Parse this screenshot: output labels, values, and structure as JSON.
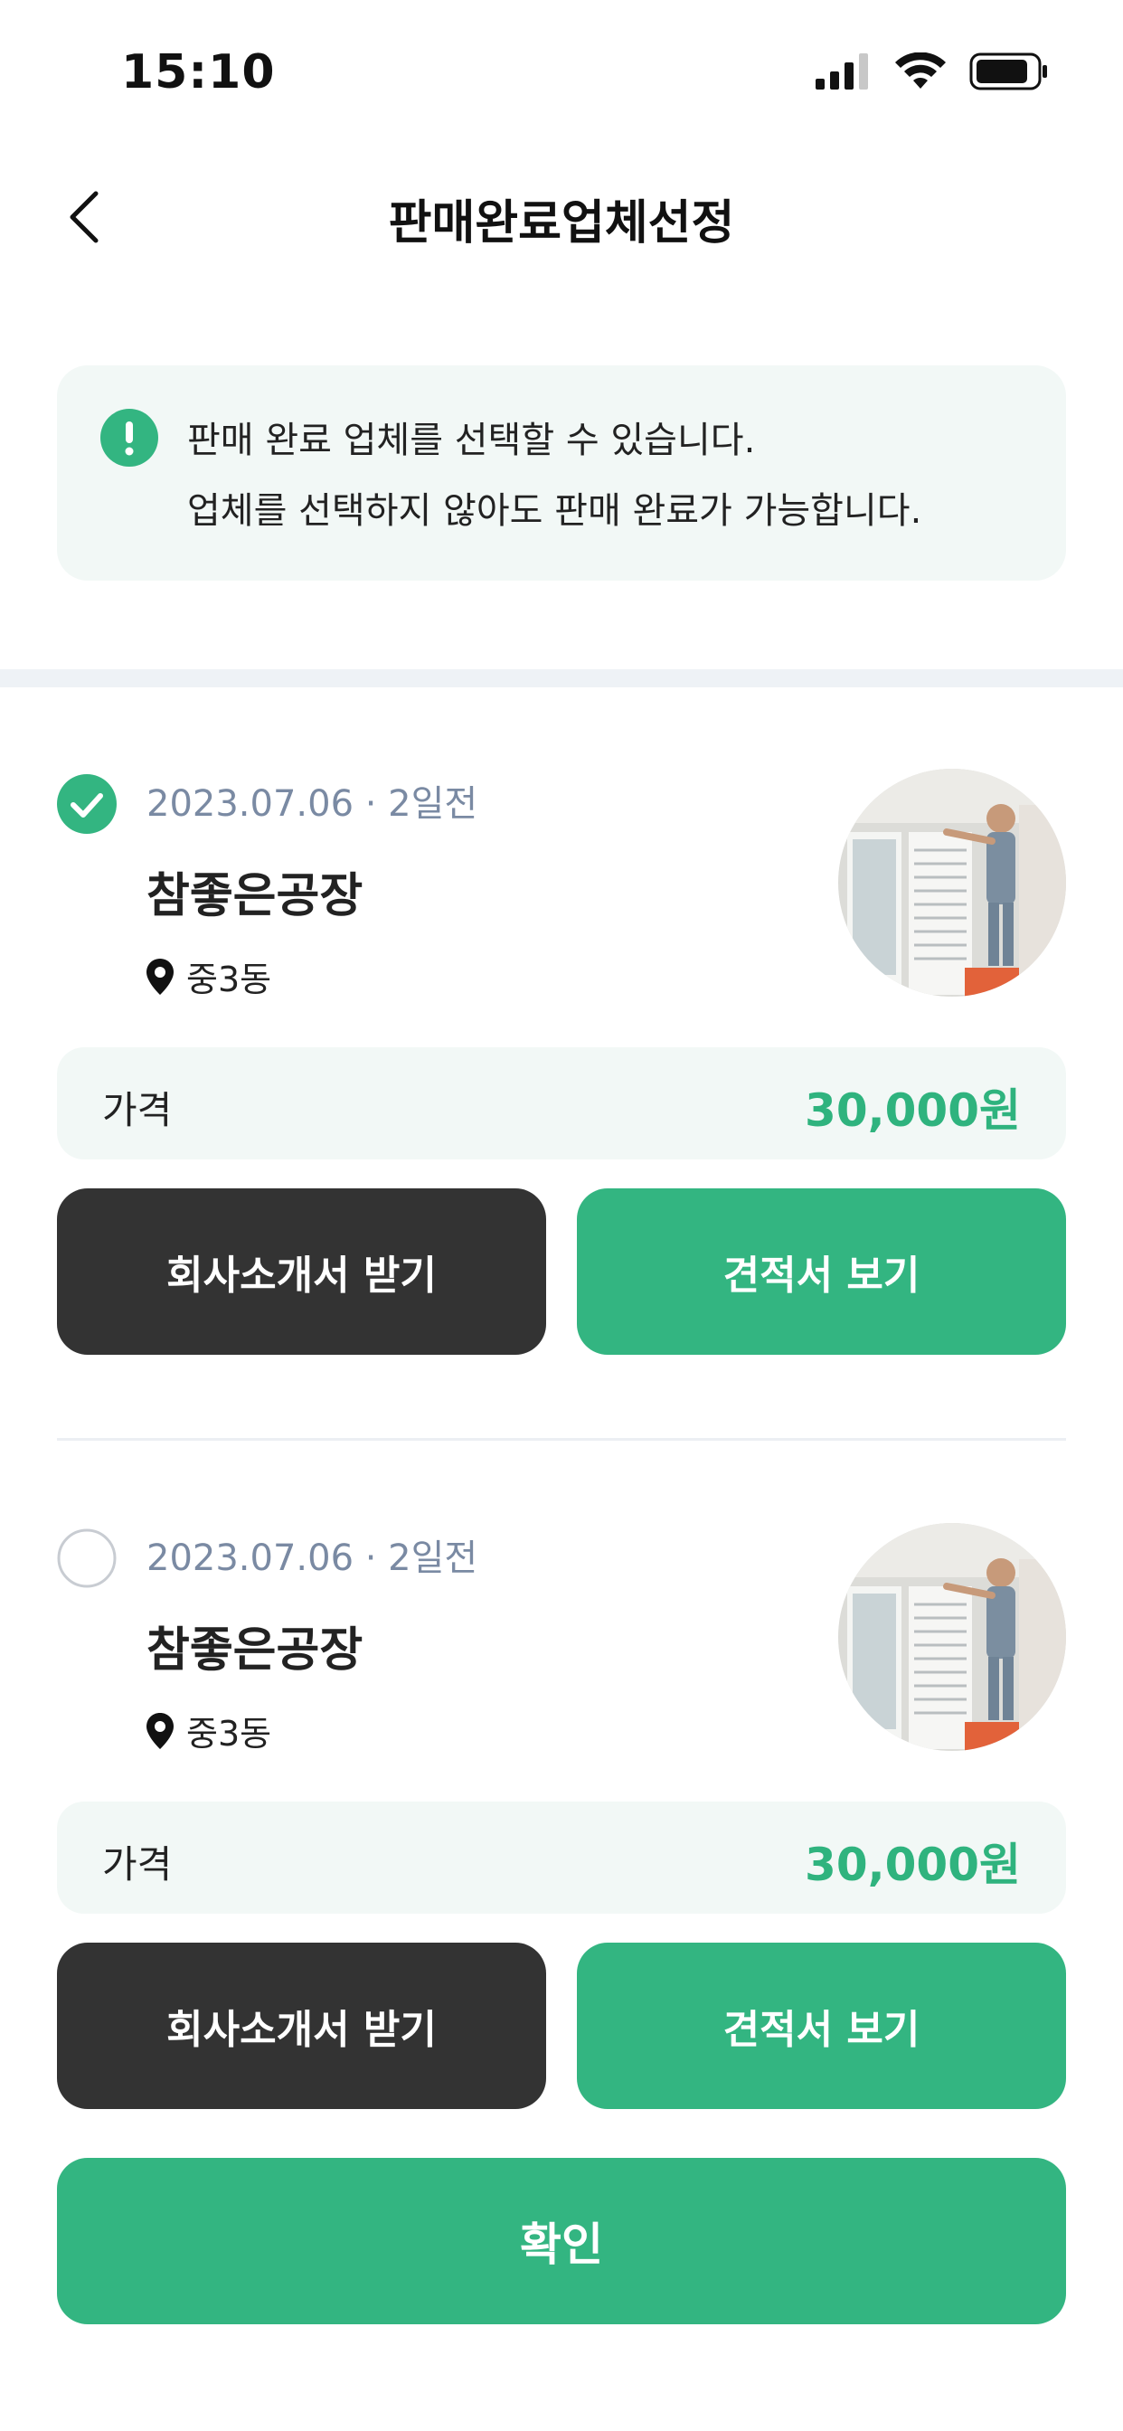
{
  "status_bar": {
    "time": "15:10"
  },
  "header": {
    "title": "판매완료업체선정"
  },
  "notice": {
    "line1": "판매 완료 업체를 선택할 수 있습니다.",
    "line2": "업체를 선택하지 않아도 판매 완료가 가능합니다."
  },
  "vendors": [
    {
      "selected": true,
      "meta": "2023.07.06 · 2일전",
      "name": "참좋은공장",
      "location": "중3동",
      "price_label": "가격",
      "price": "30,000원",
      "intro_button": "회사소개서 받기",
      "quote_button": "견적서 보기"
    },
    {
      "selected": false,
      "meta": "2023.07.06 · 2일전",
      "name": "참좋은공장",
      "location": "중3동",
      "price_label": "가격",
      "price": "30,000원",
      "intro_button": "회사소개서 받기",
      "quote_button": "견적서 보기"
    }
  ],
  "confirm_button": "확인",
  "colors": {
    "accent": "#33b581",
    "dark_button": "#333333",
    "muted_text": "#7a8aa3",
    "panel_bg": "#f2f8f6"
  }
}
